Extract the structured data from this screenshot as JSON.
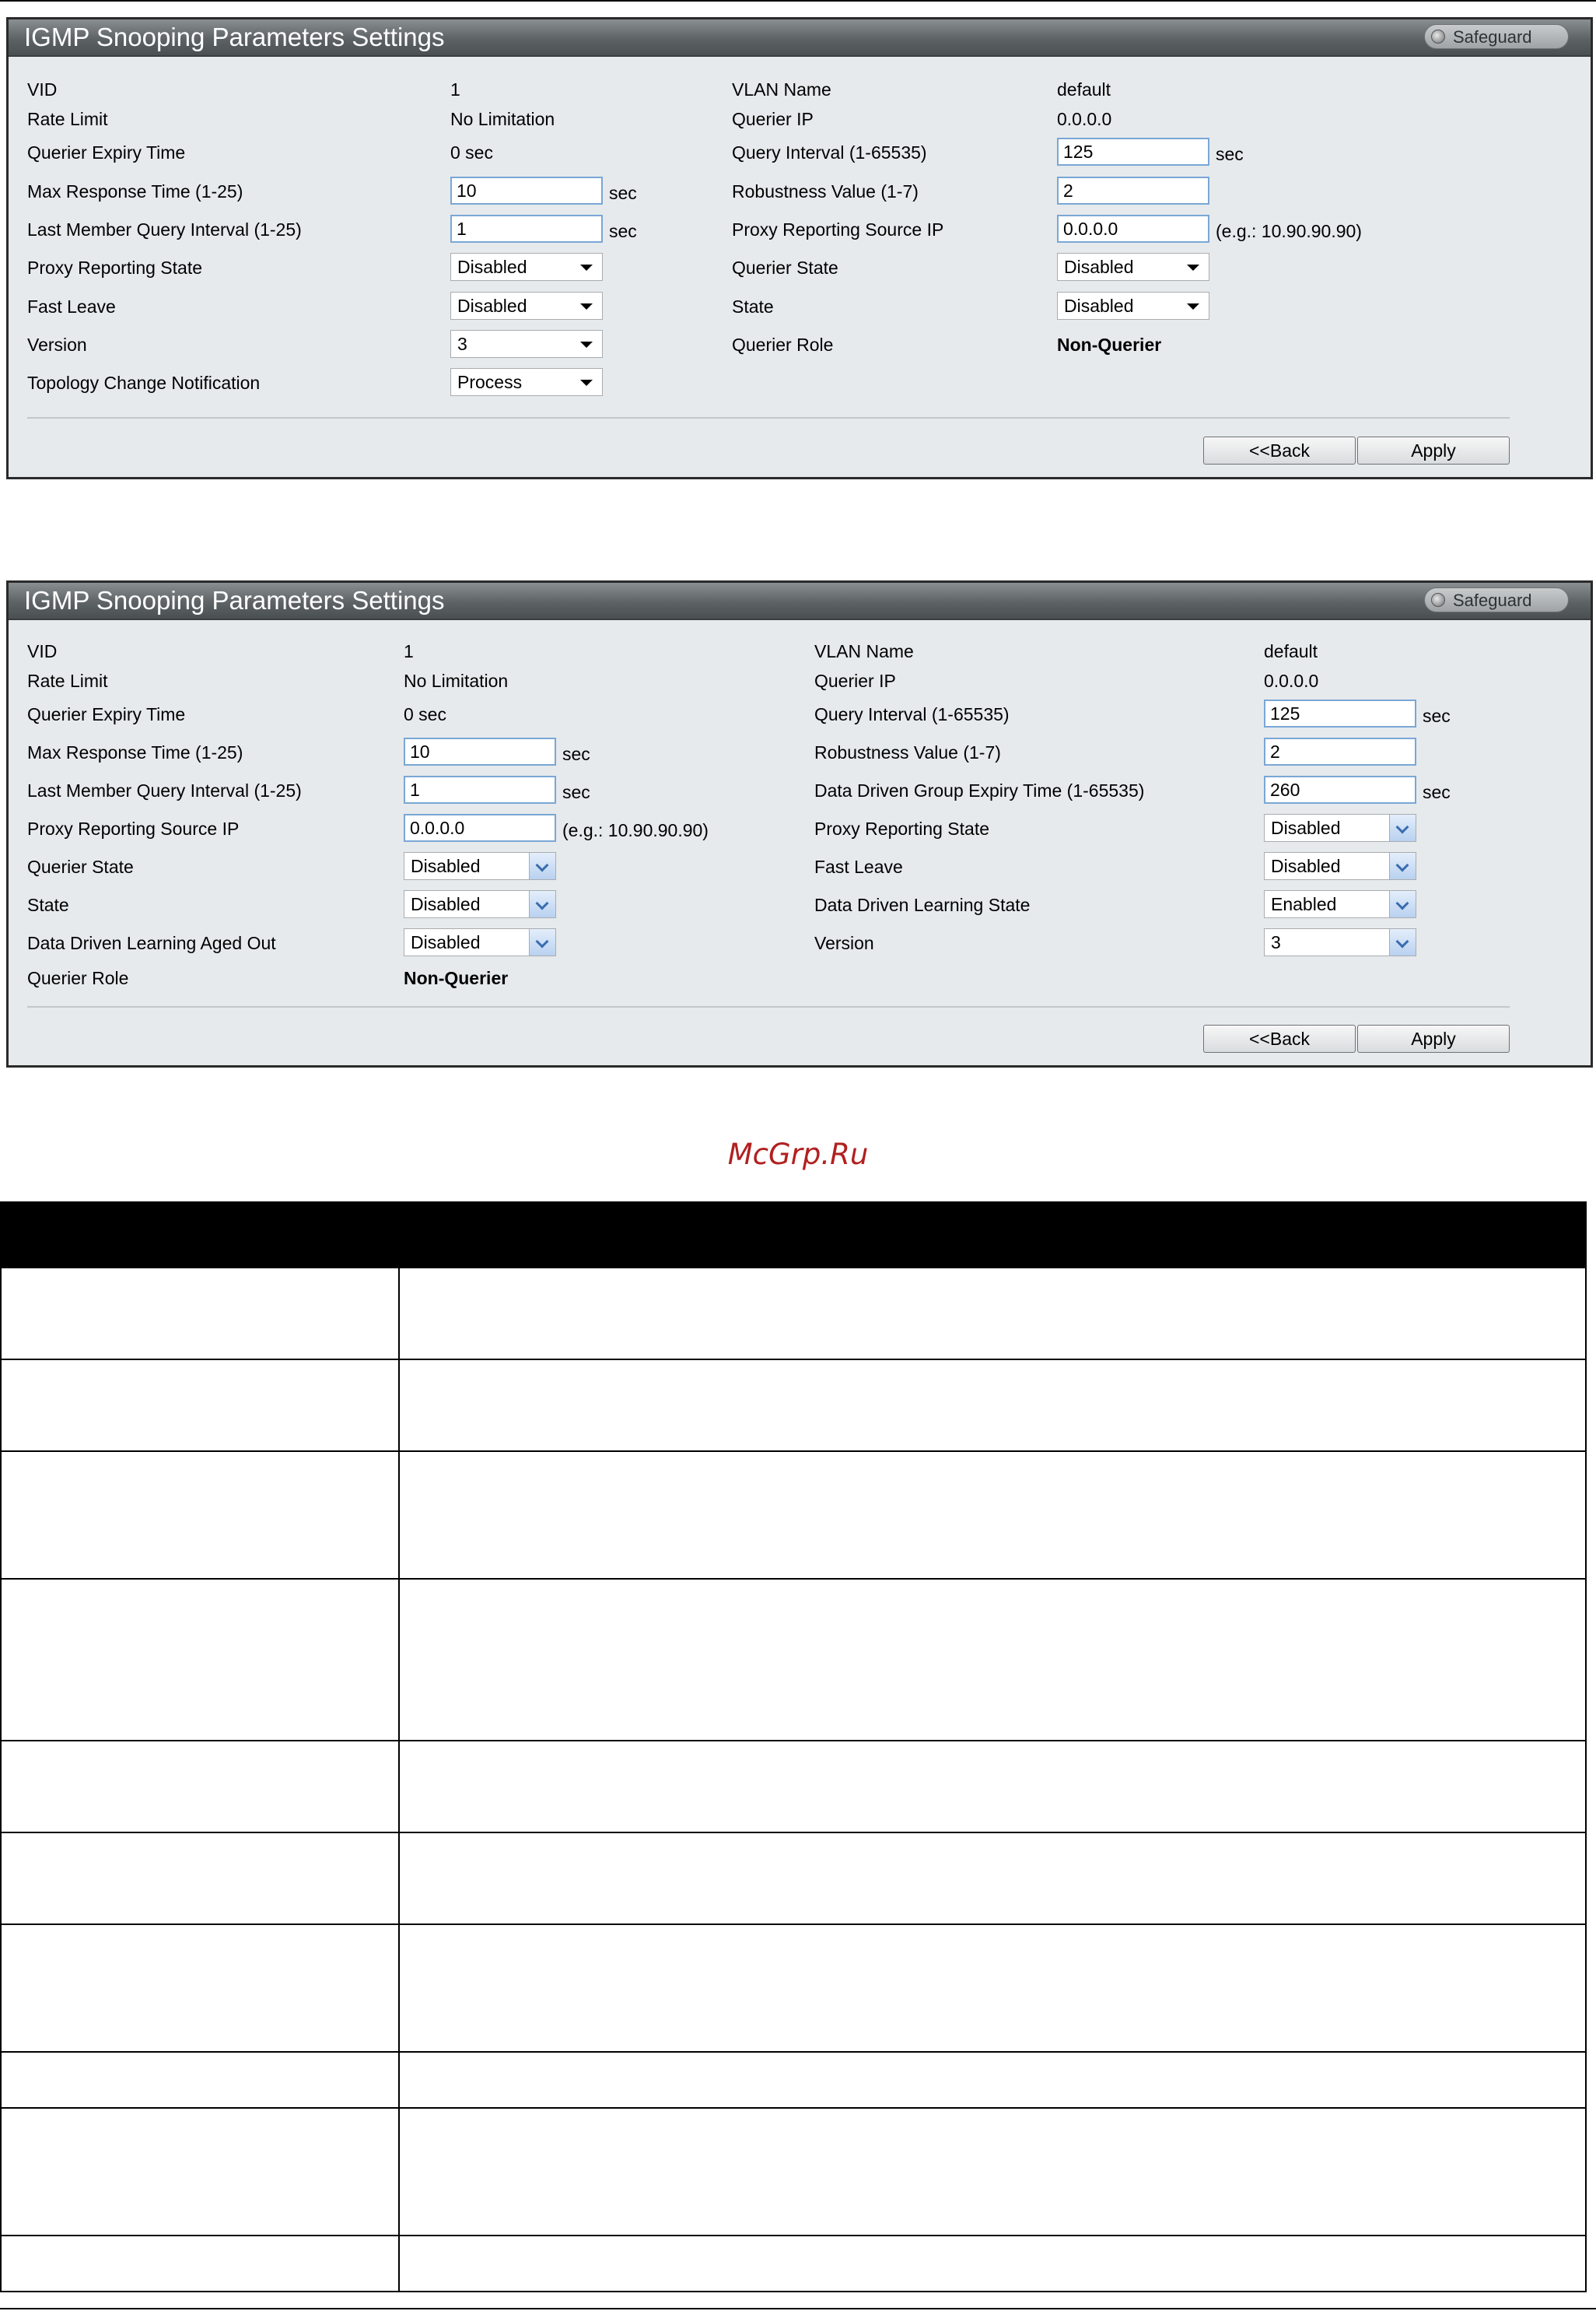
{
  "panel1": {
    "title": "IGMP Snooping Parameters Settings",
    "safeguard": "Safeguard",
    "vid_label": "VID",
    "vid_value": "1",
    "rate_limit_label": "Rate Limit",
    "rate_limit_value": "No Limitation",
    "querier_expiry_label": "Querier Expiry Time",
    "querier_expiry_value": "0 sec",
    "max_response_label": "Max Response Time (1-25)",
    "max_response_value": "10",
    "max_response_unit": "sec",
    "last_member_label": "Last Member Query Interval (1-25)",
    "last_member_value": "1",
    "last_member_unit": "sec",
    "proxy_reporting_state_label": "Proxy Reporting State",
    "proxy_reporting_state_value": "Disabled",
    "fast_leave_label": "Fast Leave",
    "fast_leave_value": "Disabled",
    "version_label": "Version",
    "version_value": "3",
    "topology_label": "Topology Change Notification",
    "topology_value": "Process",
    "vlan_name_label": "VLAN Name",
    "vlan_name_value": "default",
    "querier_ip_label": "Querier IP",
    "querier_ip_value": "0.0.0.0",
    "query_interval_label": "Query Interval (1-65535)",
    "query_interval_value": "125",
    "query_interval_unit": "sec",
    "robustness_label": "Robustness Value (1-7)",
    "robustness_value": "2",
    "proxy_source_ip_label": "Proxy Reporting Source IP",
    "proxy_source_ip_value": "0.0.0.0",
    "proxy_source_ip_hint": "(e.g.: 10.90.90.90)",
    "querier_state_label": "Querier State",
    "querier_state_value": "Disabled",
    "state_label": "State",
    "state_value": "Disabled",
    "querier_role_label": "Querier Role",
    "querier_role_value": "Non-Querier",
    "back_label": "<<Back",
    "apply_label": "Apply"
  },
  "panel2": {
    "title": "IGMP Snooping Parameters Settings",
    "safeguard": "Safeguard",
    "vid_label": "VID",
    "vid_value": "1",
    "rate_limit_label": "Rate Limit",
    "rate_limit_value": "No Limitation",
    "querier_expiry_label": "Querier Expiry Time",
    "querier_expiry_value": "0 sec",
    "max_response_label": "Max Response Time (1-25)",
    "max_response_value": "10",
    "max_response_unit": "sec",
    "last_member_label": "Last Member Query Interval (1-25)",
    "last_member_value": "1",
    "last_member_unit": "sec",
    "proxy_source_ip_label": "Proxy Reporting Source IP",
    "proxy_source_ip_value": "0.0.0.0",
    "proxy_source_ip_hint": "(e.g.: 10.90.90.90)",
    "querier_state_label": "Querier State",
    "querier_state_value": "Disabled",
    "state_label": "State",
    "state_value": "Disabled",
    "dd_aged_out_label": "Data Driven Learning Aged Out",
    "dd_aged_out_value": "Disabled",
    "querier_role_label": "Querier Role",
    "querier_role_value": "Non-Querier",
    "vlan_name_label": "VLAN Name",
    "vlan_name_value": "default",
    "querier_ip_label": "Querier IP",
    "querier_ip_value": "0.0.0.0",
    "query_interval_label": "Query Interval (1-65535)",
    "query_interval_value": "125",
    "query_interval_unit": "sec",
    "robustness_label": "Robustness Value (1-7)",
    "robustness_value": "2",
    "dd_group_expiry_label": "Data Driven Group Expiry Time (1-65535)",
    "dd_group_expiry_value": "260",
    "dd_group_expiry_unit": "sec",
    "proxy_reporting_state_label": "Proxy Reporting State",
    "proxy_reporting_state_value": "Disabled",
    "fast_leave_label": "Fast Leave",
    "fast_leave_value": "Disabled",
    "dd_learning_state_label": "Data Driven Learning State",
    "dd_learning_state_value": "Enabled",
    "version_label": "Version",
    "version_value": "3",
    "back_label": "<<Back",
    "apply_label": "Apply"
  },
  "watermark": "McGrp.Ru"
}
